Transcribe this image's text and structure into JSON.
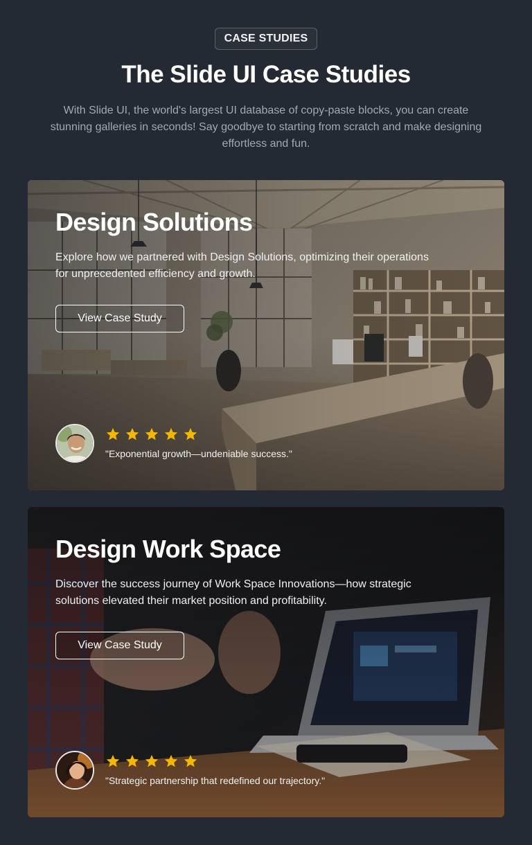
{
  "header": {
    "eyebrow": "CASE STUDIES",
    "title": "The Slide UI Case Studies",
    "subtitle": "With Slide UI, the world's largest UI database of copy-paste blocks, you can create stunning galleries in seconds! Say goodbye to starting from scratch and make designing effortless and fun."
  },
  "cards": [
    {
      "title": "Design Solutions",
      "description": "Explore how we partnered with Design Solutions, optimizing their operations for unprecedented efficiency and growth.",
      "cta": "View Case Study",
      "rating": 5,
      "quote": "\"Exponential growth—undeniable success.\""
    },
    {
      "title": "Design Work Space",
      "description": "Discover the success journey of Work Space Innovations—how strategic solutions elevated their market position and profitability.",
      "cta": "View Case Study",
      "rating": 5,
      "quote": "\"Strategic partnership that redefined our trajectory.\""
    }
  ],
  "colors": {
    "background": "#232a33",
    "star": "#f5b800"
  },
  "icons": [
    "star-icon"
  ]
}
